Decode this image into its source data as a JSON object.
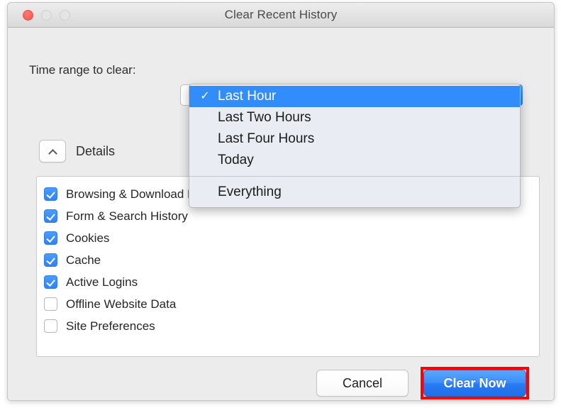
{
  "window": {
    "title": "Clear Recent History",
    "traffic_lights": [
      {
        "name": "close",
        "color": "#fc5e57"
      },
      {
        "name": "minimize",
        "color": "#e4e4e4"
      },
      {
        "name": "zoom",
        "color": "#e4e4e4"
      }
    ]
  },
  "time_range": {
    "label": "Time range to clear:",
    "selected": "Last Hour",
    "options": [
      {
        "label": "Last Hour",
        "selected": true
      },
      {
        "label": "Last Two Hours",
        "selected": false
      },
      {
        "label": "Last Four Hours",
        "selected": false
      },
      {
        "label": "Today",
        "selected": false
      },
      {
        "label": "Everything",
        "selected": false
      }
    ],
    "checkmark_glyph": "✓"
  },
  "details": {
    "label": "Details",
    "expanded": true,
    "items": [
      {
        "label": "Browsing & Download History",
        "checked": true
      },
      {
        "label": "Form & Search History",
        "checked": true
      },
      {
        "label": "Cookies",
        "checked": true
      },
      {
        "label": "Cache",
        "checked": true
      },
      {
        "label": "Active Logins",
        "checked": true
      },
      {
        "label": "Offline Website Data",
        "checked": false
      },
      {
        "label": "Site Preferences",
        "checked": false
      }
    ]
  },
  "footer": {
    "cancel_label": "Cancel",
    "clear_now_label": "Clear Now"
  },
  "colors": {
    "accent_blue": "#318cfc",
    "annotation_red": "#ff0000",
    "window_bg": "#ececec"
  }
}
